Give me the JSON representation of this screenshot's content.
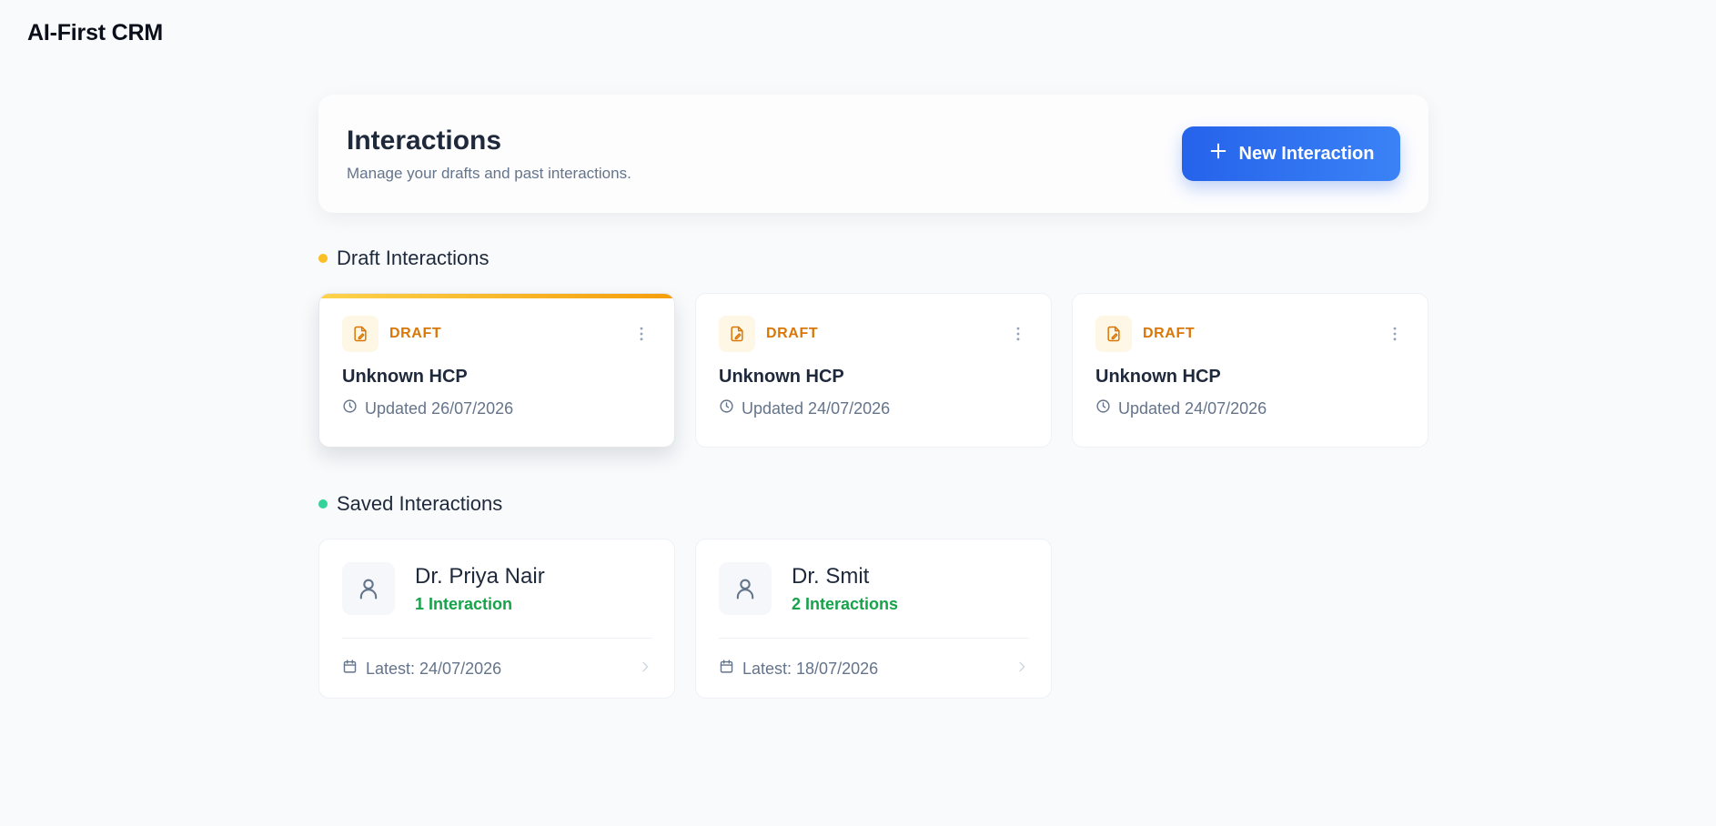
{
  "app": {
    "title": "AI-First CRM"
  },
  "header": {
    "title": "Interactions",
    "subtitle": "Manage your drafts and past interactions.",
    "new_button_label": "New Interaction"
  },
  "colors": {
    "accent": "#2563eb",
    "draft": "#d97706",
    "draft_dot": "#fbbf24",
    "saved": "#16a34a",
    "saved_dot": "#34d399"
  },
  "drafts": {
    "title": "Draft Interactions",
    "items": [
      {
        "badge": "DRAFT",
        "name": "Unknown HCP",
        "updated": "Updated 26/07/2026"
      },
      {
        "badge": "DRAFT",
        "name": "Unknown HCP",
        "updated": "Updated 24/07/2026"
      },
      {
        "badge": "DRAFT",
        "name": "Unknown HCP",
        "updated": "Updated 24/07/2026"
      }
    ]
  },
  "saved": {
    "title": "Saved Interactions",
    "items": [
      {
        "name": "Dr. Priya Nair",
        "count": "1 Interaction",
        "latest": "Latest: 24/07/2026"
      },
      {
        "name": "Dr. Smit",
        "count": "2 Interactions",
        "latest": "Latest: 18/07/2026"
      }
    ]
  }
}
